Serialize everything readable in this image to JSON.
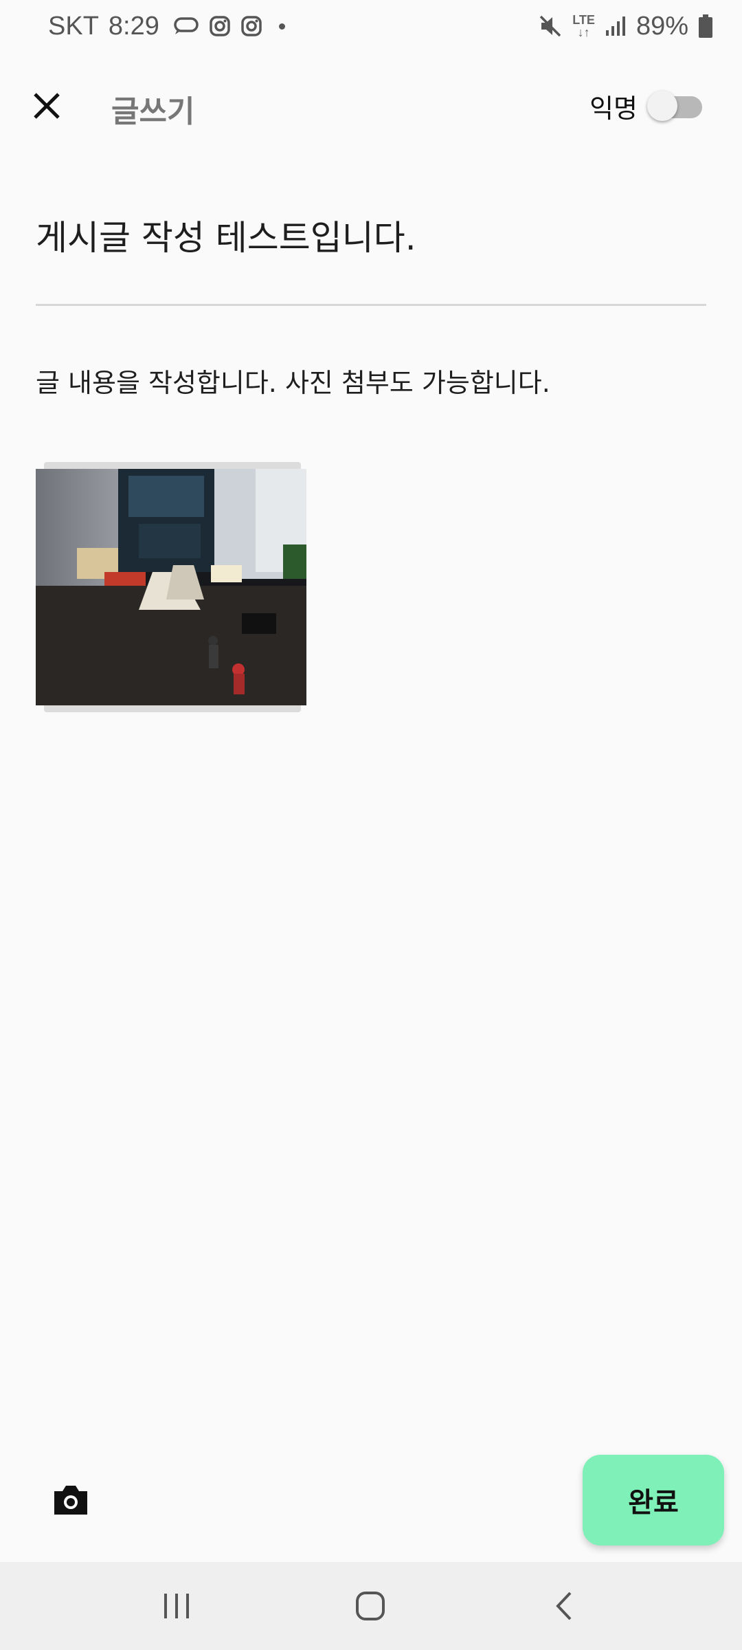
{
  "status_bar": {
    "carrier": "SKT",
    "time": "8:29",
    "network": "LTE",
    "battery": "89%",
    "icons": [
      "chat-bubble-icon",
      "instagram-icon",
      "instagram-icon",
      "notification-dot-icon",
      "mute-icon",
      "lte-icon",
      "signal-icon",
      "battery-icon"
    ]
  },
  "header": {
    "close_icon": "close-icon",
    "title": "글쓰기",
    "anonymous_label": "익명",
    "anonymous_enabled": false
  },
  "post": {
    "title": "게시글 작성 테스트입니다.",
    "body": "글 내용을 작성합니다. 사진 첨부도 가능합니다.",
    "attachments": 1
  },
  "actions": {
    "camera_icon": "camera-icon",
    "done_label": "완료",
    "done_color": "#7ff0b8"
  },
  "navigation": {
    "buttons": [
      "recent-apps-icon",
      "home-icon",
      "back-icon"
    ]
  }
}
